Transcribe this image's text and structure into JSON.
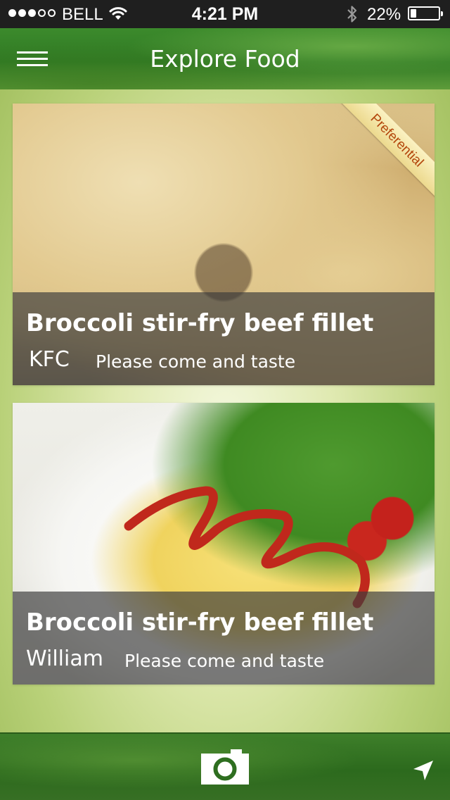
{
  "status_bar": {
    "signal_filled": 3,
    "signal_total": 5,
    "carrier": "BELL",
    "time": "4:21 PM",
    "battery_percent": "22%",
    "battery_level": 0.22
  },
  "nav": {
    "title": "Explore Food",
    "menu_icon": "hamburger-menu-icon"
  },
  "cards": [
    {
      "ribbon": "Preferential",
      "dish_name": "Broccoli stir-fry beef fillet",
      "restaurant": "KFC",
      "tagline": "Please come and taste"
    },
    {
      "dish_name": "Broccoli stir-fry beef fillet",
      "restaurant": "William",
      "tagline": "Please come and taste"
    }
  ],
  "toolbar": {
    "camera_icon": "camera-icon",
    "location_icon": "location-arrow-icon"
  },
  "colors": {
    "status_bar_bg": "#1f1f1f",
    "nav_green": "#2f7a24",
    "caption_overlay": "#3c3c3c",
    "ribbon_text": "#b3460c"
  }
}
